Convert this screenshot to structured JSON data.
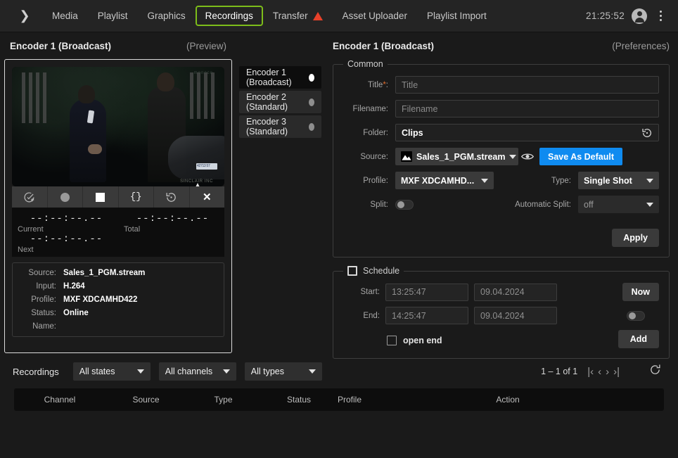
{
  "topnav": {
    "expand_icon": "chevron-right-icon",
    "items": [
      {
        "label": "Media",
        "active": false
      },
      {
        "label": "Playlist",
        "active": false
      },
      {
        "label": "Graphics",
        "active": false
      },
      {
        "label": "Recordings",
        "active": true
      },
      {
        "label": "Transfer",
        "active": false,
        "warning": true
      },
      {
        "label": "Asset Uploader",
        "active": false
      },
      {
        "label": "Playlist Import",
        "active": false
      }
    ],
    "clock": "21:25:52",
    "avatar_icon": "user-avatar-icon",
    "menu_icon": "kebab-menu-icon",
    "active_outline_color": "#7dbd1a",
    "warning_color": "#e8412a"
  },
  "preview": {
    "title": "Encoder 1 (Broadcast)",
    "subtitle": "(Preview)",
    "video_watermark_top": "monoco",
    "video_watermark_bottom": "SINCLAIR INC",
    "video_plate": "42713 57",
    "controls": [
      {
        "name": "add-to-playlist-icon",
        "glyph": "check-circle-plus"
      },
      {
        "name": "record-button",
        "glyph": "record-dot"
      },
      {
        "name": "stop-button",
        "glyph": "stop-square"
      },
      {
        "name": "metadata-button",
        "glyph": "{}"
      },
      {
        "name": "history-button",
        "glyph": "restore-arrow"
      },
      {
        "name": "close-button",
        "glyph": "x"
      }
    ],
    "timecode": {
      "current_value": "--:--:--.--",
      "current_label": "Current",
      "total_value": "--:--:--.--",
      "total_label": "Total",
      "next_value": "--:--:--.--",
      "next_label": "Next"
    },
    "info": [
      {
        "label": "Source:",
        "value": "Sales_1_PGM.stream"
      },
      {
        "label": "Input:",
        "value": "H.264"
      },
      {
        "label": "Profile:",
        "value": "MXF XDCAMHD422"
      },
      {
        "label": "Status:",
        "value": "Online"
      },
      {
        "label": "Name:",
        "value": ""
      }
    ]
  },
  "encoders": [
    {
      "label": "Encoder 1 (Broadcast)",
      "selected": true,
      "active": true
    },
    {
      "label": "Encoder 2 (Standard)",
      "selected": false,
      "active": false
    },
    {
      "label": "Encoder 3 (Standard)",
      "selected": false,
      "active": false
    }
  ],
  "preferences": {
    "title": "Encoder 1 (Broadcast)",
    "subtitle": "(Preferences)",
    "common": {
      "legend": "Common",
      "title_label": "Title",
      "title_required_mark": "*",
      "title_colon": ":",
      "title_placeholder": "Title",
      "filename_label": "Filename:",
      "filename_placeholder": "Filename",
      "folder_label": "Folder:",
      "folder_value": "Clips",
      "folder_reset_icon": "restore-icon",
      "source_label": "Source:",
      "source_value": "Sales_1_PGM.stream",
      "source_icon": "stream-source-icon",
      "preview_eye_icon": "eye-icon",
      "save_default_label": "Save As Default",
      "save_default_color": "#0f8bf0",
      "profile_label": "Profile:",
      "profile_value": "MXF XDCAMHD...",
      "type_label": "Type:",
      "type_value": "Single Shot",
      "split_label": "Split:",
      "split_on": false,
      "auto_split_label": "Automatic Split:",
      "auto_split_value": "off",
      "apply_label": "Apply"
    },
    "schedule": {
      "legend": "Schedule",
      "enabled": false,
      "start_label": "Start:",
      "start_time": "13:25:47",
      "start_date": "09.04.2024",
      "end_label": "End:",
      "end_time": "14:25:47",
      "end_date": "09.04.2024",
      "now_label": "Now",
      "repeat_on": false,
      "add_label": "Add",
      "open_end_label": "open end",
      "open_end_checked": false
    }
  },
  "recordings": {
    "title": "Recordings",
    "filters": [
      {
        "name": "states-filter",
        "value": "All states"
      },
      {
        "name": "channels-filter",
        "value": "All channels"
      },
      {
        "name": "types-filter",
        "value": "All types"
      }
    ],
    "pagination": "1 – 1 of 1",
    "pager_first": "|‹",
    "pager_prev": "‹",
    "pager_next": "›",
    "pager_last": "›|",
    "reload_icon": "refresh-icon",
    "columns": [
      "Channel",
      "Source",
      "Type",
      "Status",
      "Profile",
      "Action"
    ],
    "rows": []
  }
}
